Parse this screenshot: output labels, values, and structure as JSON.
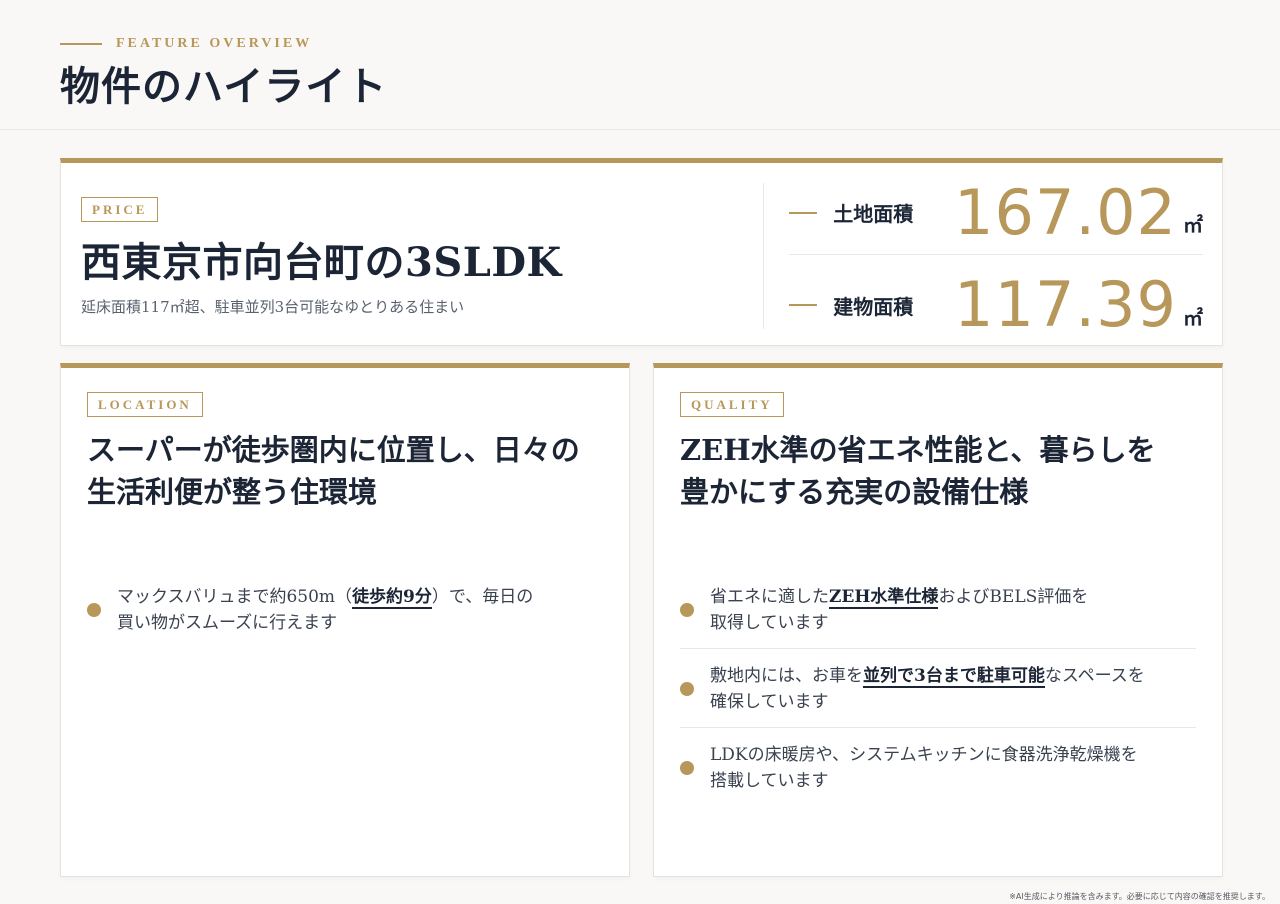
{
  "header": {
    "eyebrow": "FEATURE OVERVIEW",
    "title": "物件のハイライト"
  },
  "price_card": {
    "tag": "PRICE",
    "title": "西東京市向台町の3SLDK",
    "subtitle": "延床面積117㎡超、駐車並列3台可能なゆとりある住まい",
    "areas": [
      {
        "label": "土地面積",
        "value": "167.02",
        "unit": "㎡"
      },
      {
        "label": "建物面積",
        "value": "117.39",
        "unit": "㎡"
      }
    ]
  },
  "location_card": {
    "tag": "LOCATION",
    "heading_line1": "スーパーが徒歩圏内に位置し、日々の",
    "heading_line2": "生活利便が整う住環境",
    "bullets": [
      {
        "pre": "マックスバリュまで約650m（",
        "strong": "徒歩約9分",
        "post": "）で、毎日の",
        "line2": "買い物がスムーズに行えます"
      }
    ]
  },
  "quality_card": {
    "tag": "QUALITY",
    "heading_line1": "ZEH水準の省エネ性能と、暮らしを",
    "heading_line2": "豊かにする充実の設備仕様",
    "bullets": [
      {
        "pre": "省エネに適した",
        "strong": "ZEH水準仕様",
        "post": "およびBELS評価を",
        "line2": "取得しています"
      },
      {
        "pre": "敷地内には、お車を",
        "strong": "並列で3台まで駐車可能",
        "post": "なスペースを",
        "line2": "確保しています"
      },
      {
        "pre": "LDKの床暖房や、システムキッチンに食器洗浄乾燥機を",
        "strong": "",
        "post": "",
        "line2": "搭載しています"
      }
    ]
  },
  "footnote": "※AI生成により推論を含みます。必要に応じて内容の確認を推奨します。",
  "colors": {
    "accent": "#b8985a",
    "text": "#1c2536"
  }
}
